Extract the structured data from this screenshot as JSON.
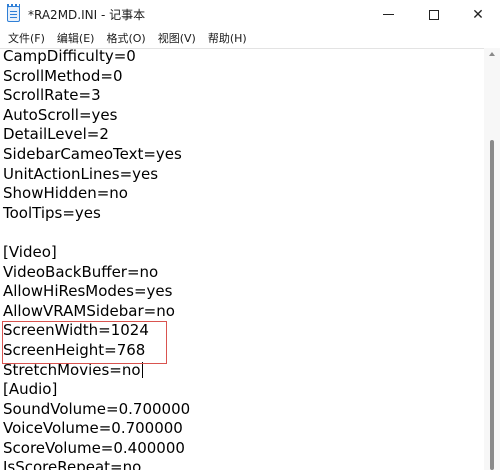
{
  "window": {
    "title": "*RA2MD.INI - 记事本",
    "controls": {
      "minimize": "minimize",
      "maximize": "maximize",
      "close": "✕"
    }
  },
  "menu": {
    "items": [
      {
        "label": "文件(F)"
      },
      {
        "label": "编辑(E)"
      },
      {
        "label": "格式(O)"
      },
      {
        "label": "视图(V)"
      },
      {
        "label": "帮助(H)"
      }
    ]
  },
  "document": {
    "lines": [
      "CampDifficulty=0",
      "ScrollMethod=0",
      "ScrollRate=3",
      "AutoScroll=yes",
      "DetailLevel=2",
      "SidebarCameoText=yes",
      "UnitActionLines=yes",
      "ShowHidden=no",
      "ToolTips=yes",
      "",
      "[Video]",
      "VideoBackBuffer=no",
      "AllowHiResModes=yes",
      "AllowVRAMSidebar=no",
      "ScreenWidth=1024",
      "ScreenHeight=768",
      "StretchMovies=no",
      "[Audio]",
      "SoundVolume=0.700000",
      "VoiceVolume=0.700000",
      "ScoreVolume=0.400000",
      "IsScoreRepeat=no"
    ],
    "highlight_color": "#d9534f"
  },
  "icons": {
    "app": "notepad-icon"
  }
}
